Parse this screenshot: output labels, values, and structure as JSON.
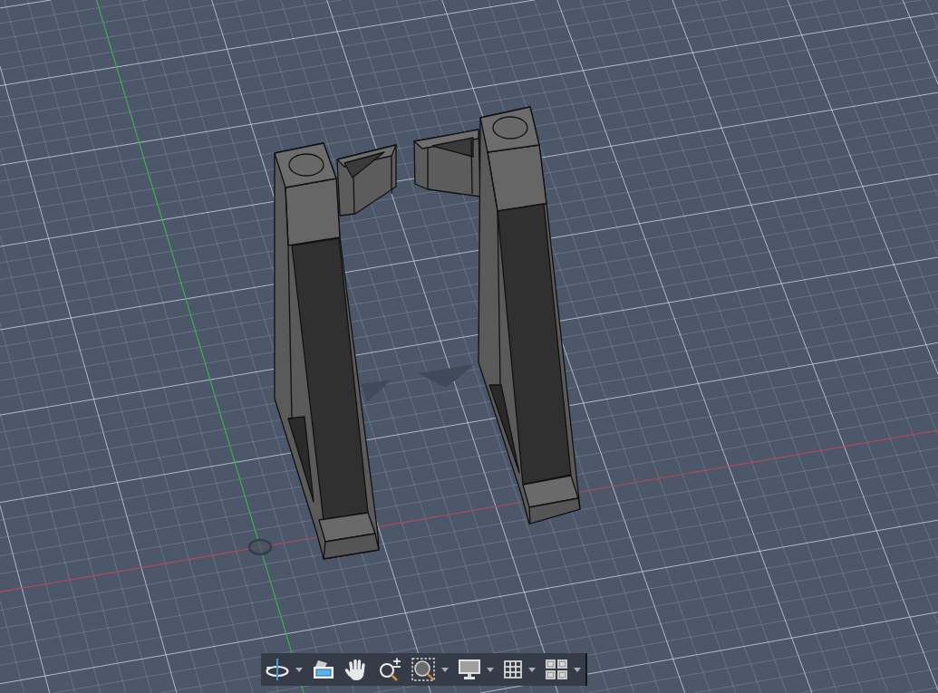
{
  "viewport": {
    "parts": [
      {
        "kind": "bracket"
      },
      {
        "kind": "bracket"
      }
    ]
  },
  "navigation_bar": {
    "tools": [
      {
        "kind": "orbit",
        "dropdown": true
      },
      {
        "kind": "look_at",
        "dropdown": false
      },
      {
        "kind": "pan",
        "dropdown": false
      },
      {
        "kind": "zoom",
        "dropdown": false
      },
      {
        "kind": "fit",
        "dropdown": true
      },
      {
        "kind": "display",
        "dropdown": true
      },
      {
        "kind": "grid",
        "dropdown": true
      },
      {
        "kind": "viewports",
        "dropdown": true
      }
    ]
  }
}
